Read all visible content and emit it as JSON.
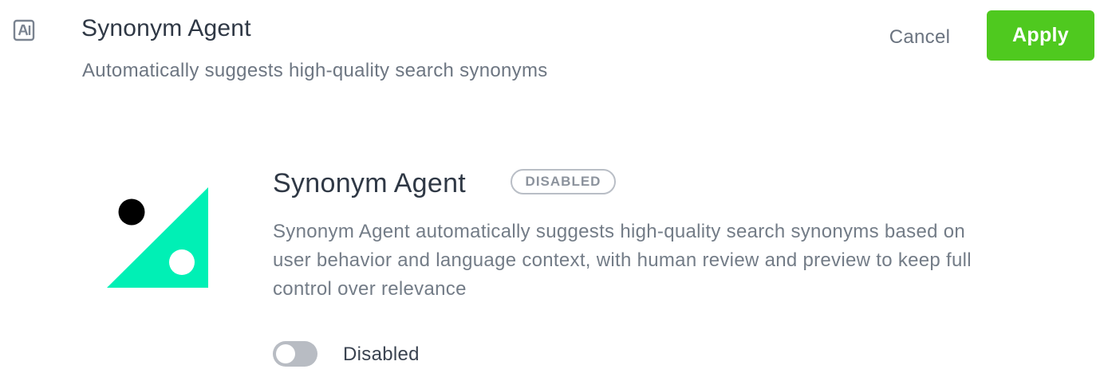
{
  "header": {
    "icon": "ai-icon",
    "title": "Synonym Agent",
    "subtitle": "Automatically suggests high-quality search synonyms",
    "cancel_label": "Cancel",
    "apply_label": "Apply"
  },
  "card": {
    "logo": "synonym-agent-logo",
    "title": "Synonym Agent",
    "status_badge": "DISABLED",
    "description": "Synonym Agent automatically suggests high-quality search synonyms based on user behavior and language context, with human review and preview to keep full control over relevance",
    "toggle_state": "off",
    "toggle_label": "Disabled"
  },
  "colors": {
    "apply_button": "#4fc91f",
    "logo_triangle": "#00f0b5",
    "toggle_off": "#b8bcc3",
    "text_dark": "#2f3845",
    "text_muted": "#737c87"
  }
}
